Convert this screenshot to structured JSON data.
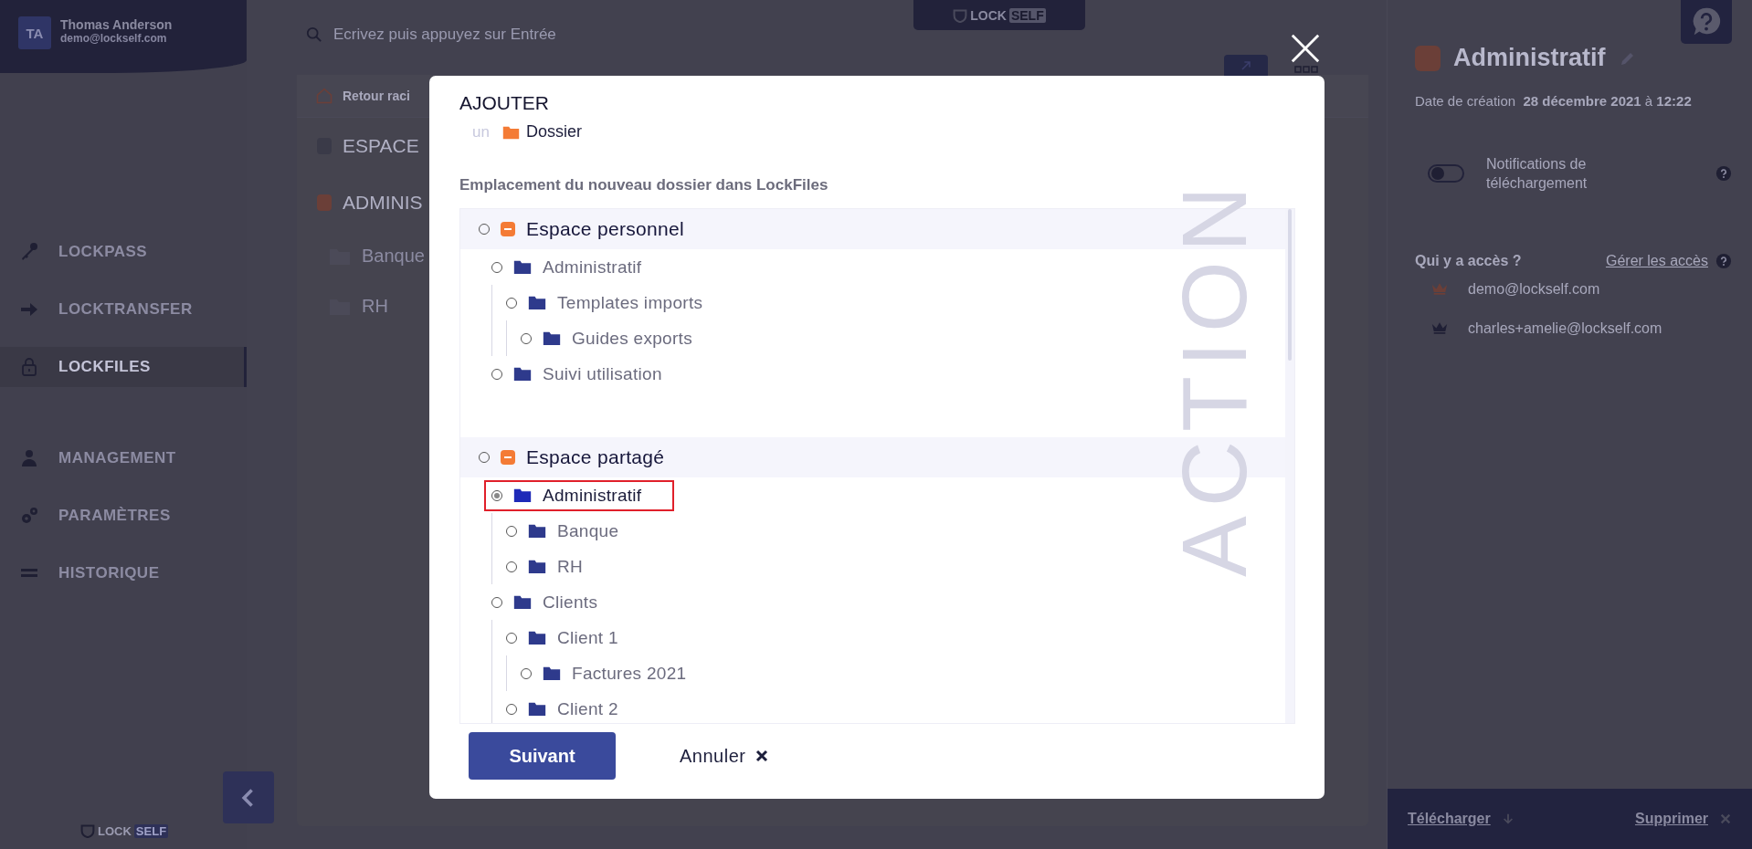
{
  "user": {
    "initials": "TA",
    "name": "Thomas Anderson",
    "email": "demo@lockself.com"
  },
  "nav": [
    {
      "label": "LOCKPASS",
      "selected": false
    },
    {
      "label": "LOCKTRANSFER",
      "selected": false
    },
    {
      "label": "LOCKFILES",
      "selected": true
    },
    {
      "label": "MANAGEMENT",
      "selected": false
    },
    {
      "label": "PARAMÈTRES",
      "selected": false
    },
    {
      "label": "HISTORIQUE",
      "selected": false
    }
  ],
  "logo_bottom": {
    "lock": "LOCK",
    "self": "SELF"
  },
  "logo_top": {
    "lock": "LOCK",
    "self": "SELF"
  },
  "search": {
    "placeholder": "Ecrivez puis appuyez sur Entrée"
  },
  "breadcrumb": "Retour raci",
  "background_tree": [
    {
      "label": "ESPACE",
      "kind": "space",
      "color": "#3a3a48"
    },
    {
      "label": "ADMINIS",
      "kind": "space",
      "color": "#6b3f38"
    },
    {
      "label": "Banque",
      "kind": "folder"
    },
    {
      "label": "RH",
      "kind": "folder"
    }
  ],
  "modal": {
    "title": "AJOUTER",
    "prefix": "un",
    "type": "Dossier",
    "location_label": "Emplacement du nouveau dossier dans LockFiles",
    "watermark": "ACTION",
    "tree": [
      {
        "label": "Espace personnel",
        "selected": false,
        "children": [
          {
            "label": "Administratif",
            "selected": false,
            "children": [
              {
                "label": "Templates imports",
                "selected": false,
                "children": [
                  {
                    "label": "Guides exports",
                    "selected": false
                  }
                ]
              }
            ]
          },
          {
            "label": "Suivi utilisation",
            "selected": false
          }
        ]
      },
      {
        "label": "Espace partagé",
        "selected": false,
        "children": [
          {
            "label": "Administratif",
            "selected": true,
            "children": [
              {
                "label": "Banque",
                "selected": false
              },
              {
                "label": "RH",
                "selected": false
              }
            ]
          },
          {
            "label": "Clients",
            "selected": false,
            "children": [
              {
                "label": "Client 1",
                "selected": false,
                "children": [
                  {
                    "label": "Factures 2021",
                    "selected": false
                  }
                ]
              },
              {
                "label": "Client 2",
                "selected": false
              }
            ]
          }
        ]
      }
    ],
    "next": "Suivant",
    "cancel": "Annuler"
  },
  "details": {
    "title": "Administratif",
    "date_label": "Date de création",
    "date": "28 décembre 2021",
    "date_at": "à",
    "time": "12:22",
    "notifications": {
      "label": "Notifications de téléchargement",
      "on": false
    },
    "access_title": "Qui y a accès ?",
    "manage": "Gérer les accès",
    "users": [
      {
        "email": "demo@lockself.com",
        "color": "#6b3f38"
      },
      {
        "email": "charles+amelie@lockself.com",
        "color": "#1f1f35"
      }
    ],
    "download": "Télécharger",
    "delete": "Supprimer"
  }
}
